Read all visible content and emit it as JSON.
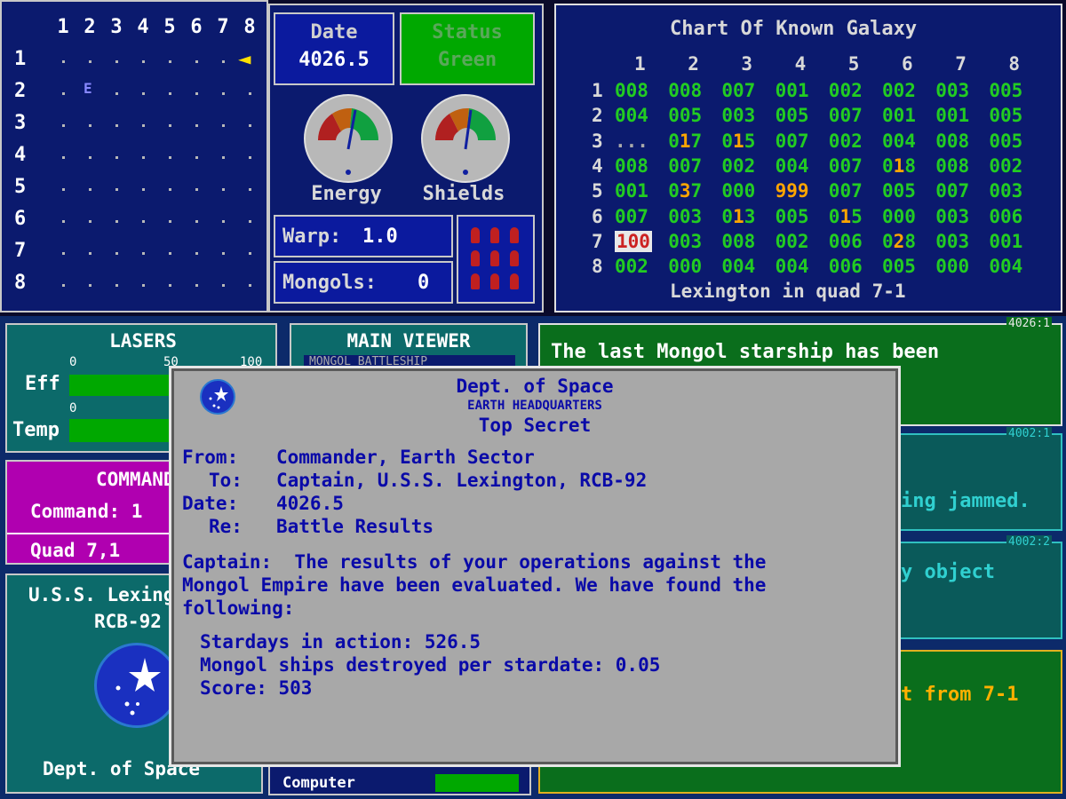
{
  "sector_map": {
    "columns": [
      "1",
      "2",
      "3",
      "4",
      "5",
      "6",
      "7",
      "8"
    ],
    "rows": [
      "1",
      "2",
      "3",
      "4",
      "5",
      "6",
      "7",
      "8"
    ],
    "ship_glyph": "◄",
    "enemy_glyph": "E"
  },
  "date": {
    "label": "Date",
    "value": "4026.5"
  },
  "status": {
    "label": "Status",
    "value": "Green"
  },
  "gauges": {
    "energy_label": "Energy",
    "shields_label": "Shields"
  },
  "warp": {
    "label": "Warp:",
    "value": "1.0"
  },
  "mongols": {
    "label": "Mongols:",
    "value": "0"
  },
  "galaxy": {
    "title": "Chart Of Known Galaxy",
    "columns": [
      "1",
      "2",
      "3",
      "4",
      "5",
      "6",
      "7",
      "8"
    ],
    "rows": [
      {
        "label": "1",
        "cells": [
          "008",
          "008",
          "007",
          "001",
          "002",
          "002",
          "003",
          "005"
        ]
      },
      {
        "label": "2",
        "cells": [
          "004",
          "005",
          "003",
          "005",
          "007",
          "001",
          "001",
          "005"
        ]
      },
      {
        "label": "3",
        "cells": [
          "...",
          "017",
          "015",
          "007",
          "002",
          "004",
          "008",
          "005"
        ]
      },
      {
        "label": "4",
        "cells": [
          "008",
          "007",
          "002",
          "004",
          "007",
          "018",
          "008",
          "002"
        ]
      },
      {
        "label": "5",
        "cells": [
          "001",
          "037",
          "000",
          "999",
          "007",
          "005",
          "007",
          "003"
        ]
      },
      {
        "label": "6",
        "cells": [
          "007",
          "003",
          "013",
          "005",
          "015",
          "000",
          "003",
          "006"
        ]
      },
      {
        "label": "7",
        "cells": [
          "100",
          "003",
          "008",
          "002",
          "006",
          "028",
          "003",
          "001"
        ]
      },
      {
        "label": "8",
        "cells": [
          "002",
          "000",
          "004",
          "004",
          "006",
          "005",
          "000",
          "004"
        ]
      }
    ],
    "footer": "Lexington in quad 7-1",
    "colors": {
      "normal": "#22cc22",
      "highlight": "#ffa500",
      "current": "#cc2222"
    }
  },
  "lasers": {
    "title": "LASERS",
    "scale": [
      "0",
      "50",
      "100"
    ],
    "eff_label": "Eff",
    "temp_scale": "0",
    "temp_label": "Temp"
  },
  "main_viewer": {
    "title": "MAIN VIEWER",
    "subtitle": "MONGOL BATTLESHIP"
  },
  "command": {
    "title": "COMMAND",
    "command_label": "Command: 1",
    "quad_label": "Quad 7,1"
  },
  "ship": {
    "name": "U.S.S. Lexington",
    "registry": "RCB-92",
    "footer": "Dept. of Space"
  },
  "damage": {
    "computer_label": "Computer"
  },
  "messages": [
    {
      "tag": "4026:1",
      "text": "The last Mongol starship has been"
    },
    {
      "tag": "4002:1",
      "text": "ing jammed."
    },
    {
      "tag": "4002:2",
      "text": "y object"
    },
    {
      "tag": "",
      "text": "t from 7-1"
    }
  ],
  "dialog": {
    "org": "Dept. of Space",
    "suborg": "EARTH HEADQUARTERS",
    "classification": "Top Secret",
    "from_label": "From:",
    "from_value": "Commander, Earth Sector",
    "to_label": "To:",
    "to_value": "Captain, U.S.S. Lexington, RCB-92",
    "date_label": "Date:",
    "date_value": "4026.5",
    "re_label": "Re:",
    "re_value": "Battle Results",
    "body_line1": "Captain:  The results of your operations against the",
    "body_line2": "Mongol Empire have been evaluated. We have found the",
    "body_line3": "following:",
    "stat1": "Stardays in action: 526.5",
    "stat2": "Mongol ships destroyed per stardate: 0.05",
    "stat3": "Score: 503"
  }
}
